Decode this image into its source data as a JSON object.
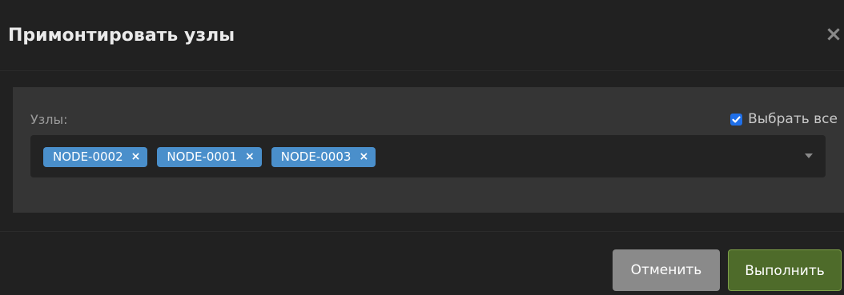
{
  "dialog": {
    "title": "Примонтировать узлы",
    "close_icon": "×"
  },
  "nodes_field": {
    "label": "Узлы:",
    "select_all": {
      "label": "Выбрать все",
      "checked": true
    },
    "selected": [
      {
        "label": "NODE-0002",
        "remove": "×"
      },
      {
        "label": "NODE-0001",
        "remove": "×"
      },
      {
        "label": "NODE-0003",
        "remove": "×"
      }
    ]
  },
  "footer": {
    "cancel_label": "Отменить",
    "run_label": "Выполнить"
  },
  "colors": {
    "tag_bg": "#4a8fcb",
    "checkbox": "#1f6fe8",
    "run_button": "#4e6b2a",
    "cancel_button": "#8a8a8a"
  }
}
